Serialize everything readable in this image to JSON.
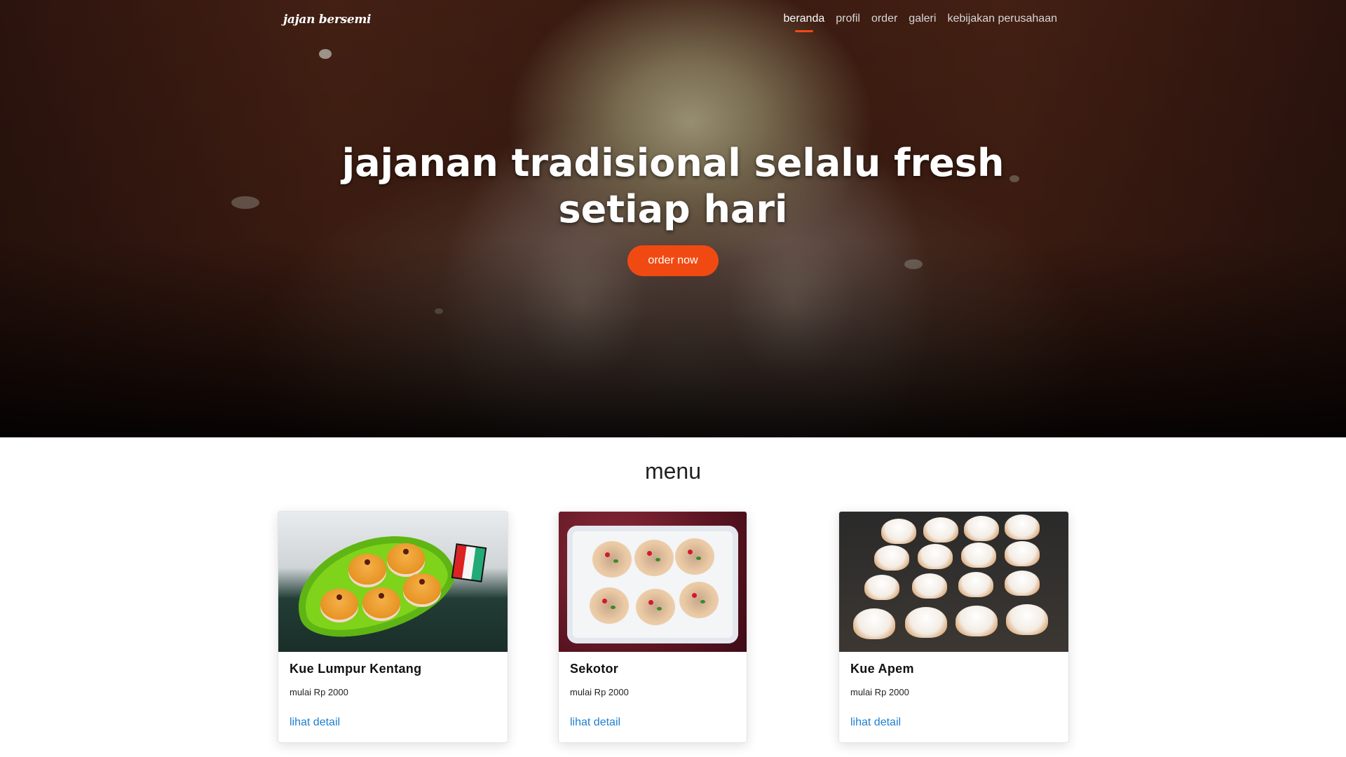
{
  "nav": {
    "logo": "jajan bersemi",
    "links": [
      "beranda",
      "profil",
      "order",
      "galeri",
      "kebijakan perusahaan"
    ],
    "active": "beranda"
  },
  "hero": {
    "title_line1": "jajanan tradisional selalu fresh",
    "title_line2": "setiap hari",
    "cta": "order now"
  },
  "menu_section": {
    "title": "menu",
    "items": [
      {
        "name": "Kue Lumpur Kentang",
        "price": "mulai Rp 2000",
        "link": "lihat detail"
      },
      {
        "name": "Sekotor",
        "price": "mulai Rp 2000",
        "link": "lihat detail"
      },
      {
        "name": "Kue Apem",
        "price": "mulai Rp 2000",
        "link": "lihat detail"
      }
    ]
  },
  "colors": {
    "accent": "#f04a12",
    "link": "#1f7fd0"
  }
}
